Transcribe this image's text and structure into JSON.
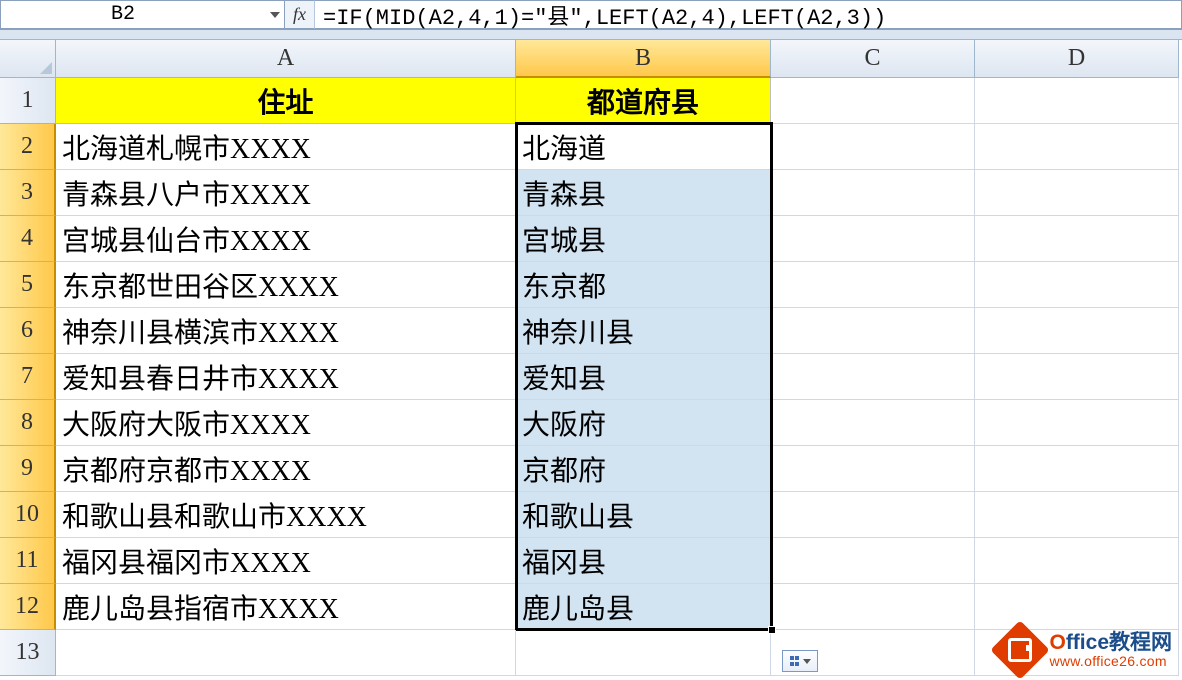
{
  "formula_bar": {
    "cell_ref": "B2",
    "fx_label": "fx",
    "formula": "=IF(MID(A2,4,1)=\"县\",LEFT(A2,4),LEFT(A2,3))"
  },
  "columns": [
    "A",
    "B",
    "C",
    "D"
  ],
  "row_labels": [
    "1",
    "2",
    "3",
    "4",
    "5",
    "6",
    "7",
    "8",
    "9",
    "10",
    "11",
    "12",
    "13"
  ],
  "header_row": {
    "A": "住址",
    "B": "都道府县"
  },
  "rows": [
    {
      "A": "北海道札幌市XXXX",
      "B": "北海道"
    },
    {
      "A": "青森县八户市XXXX",
      "B": "青森县"
    },
    {
      "A": "宫城县仙台市XXXX",
      "B": "宫城县"
    },
    {
      "A": "东京都世田谷区XXXX",
      "B": "东京都"
    },
    {
      "A": "神奈川县横滨市XXXX",
      "B": "神奈川县"
    },
    {
      "A": "爱知县春日井市XXXX",
      "B": "爱知县"
    },
    {
      "A": "大阪府大阪市XXXX",
      "B": "大阪府"
    },
    {
      "A": "京都府京都市XXXX",
      "B": "京都府"
    },
    {
      "A": "和歌山县和歌山市XXXX",
      "B": "和歌山县"
    },
    {
      "A": "福冈县福冈市XXXX",
      "B": "福冈县"
    },
    {
      "A": "鹿儿岛县指宿市XXXX",
      "B": "鹿儿岛县"
    }
  ],
  "selection": {
    "active_cell": "B2",
    "range": "B2:B12"
  },
  "watermark": {
    "title_highlight": "O",
    "title_rest": "ffice教程网",
    "url": "www.office26.com"
  }
}
